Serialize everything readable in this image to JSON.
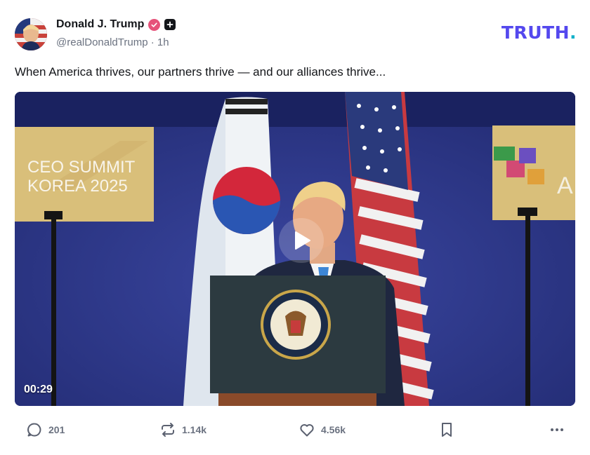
{
  "post": {
    "author_name": "Donald J. Trump",
    "handle": "@realDonaldTrump",
    "separator": "·",
    "time_ago": "1h",
    "text": "When America thrives, our partners thrive — and our alliances thrive..."
  },
  "brand": {
    "logo_text": "TRUTH",
    "logo_dot": ".",
    "logo_color": "#5448ee",
    "dot_color": "#10b0c9"
  },
  "video": {
    "duration": "00:29",
    "banner_left_line1": "CEO SUMMIT",
    "banner_left_line2": "KOREA 2025",
    "banner_right_letter": "A",
    "play_icon": "play-icon"
  },
  "actions": {
    "replies": "201",
    "retruths": "1.14k",
    "likes": "4.56k"
  },
  "colors": {
    "verified_badge": "#e6527a",
    "text": "#14161a",
    "muted": "#6b7280"
  }
}
